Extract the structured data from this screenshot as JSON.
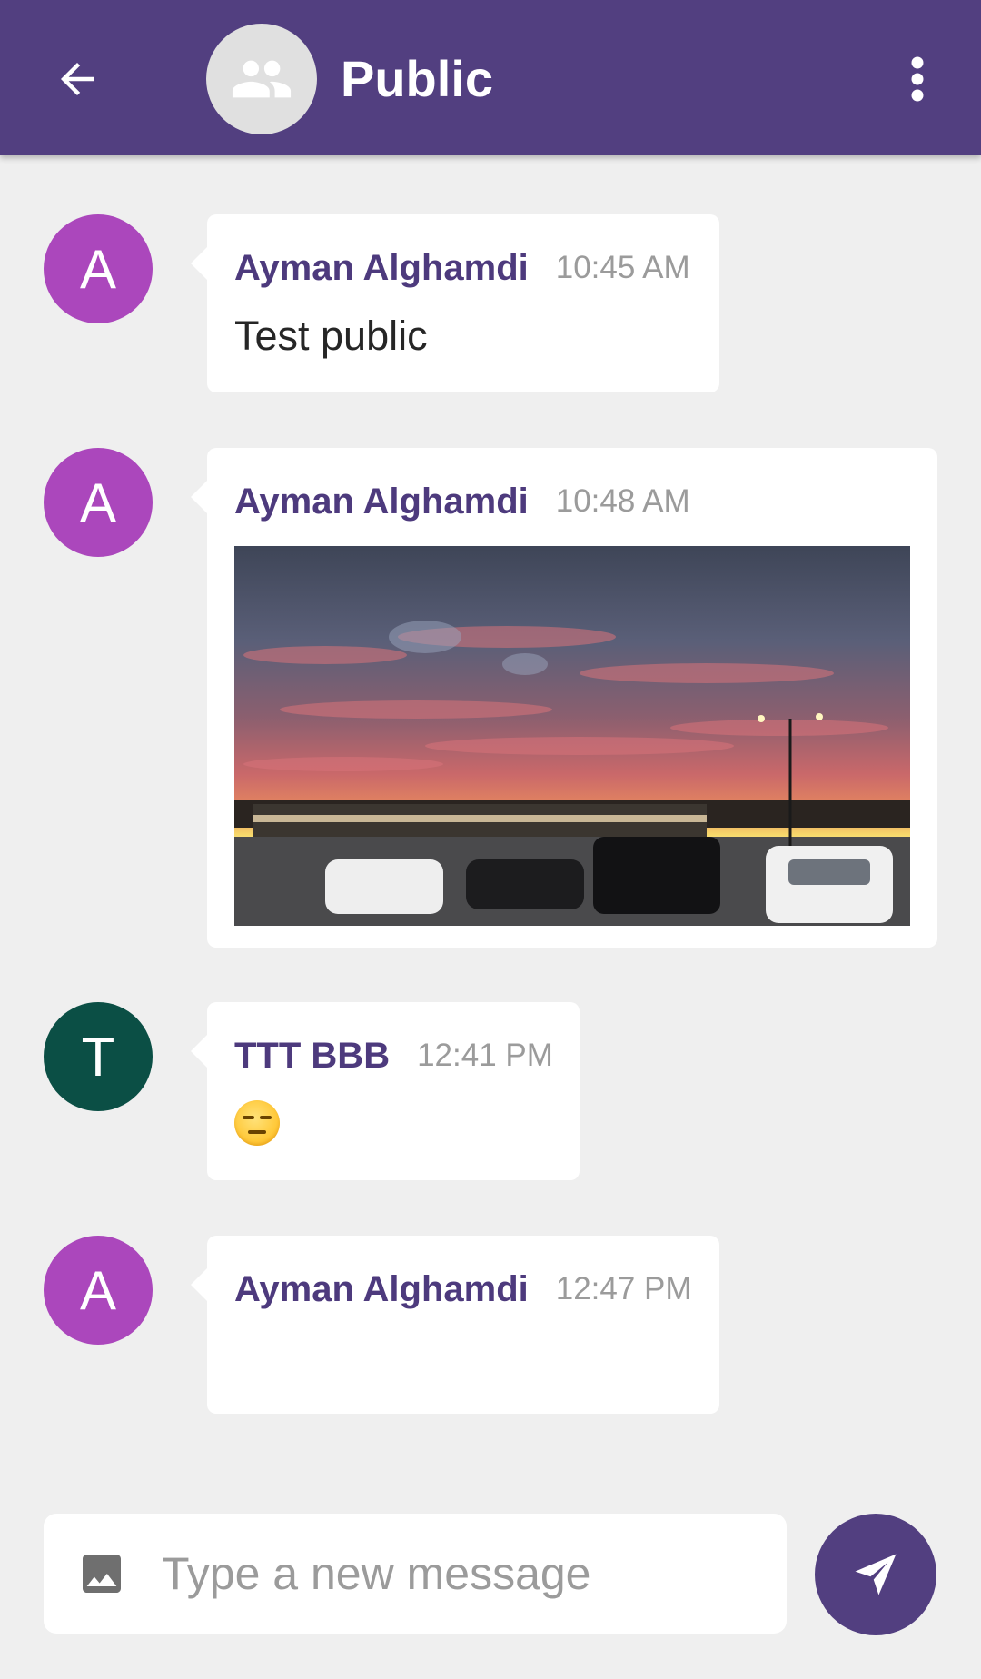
{
  "header": {
    "title": "Public",
    "bg_color": "#523f80",
    "back_icon": "arrow-back-icon",
    "group_icon": "group-icon",
    "menu_icon": "more-vert-icon"
  },
  "messages": [
    {
      "initial": "A",
      "avatar_color": "#ab47bc",
      "sender": "Ayman Alghamdi",
      "time": "10:45 AM",
      "text": "Test public"
    },
    {
      "initial": "A",
      "avatar_color": "#ab47bc",
      "sender": "Ayman Alghamdi",
      "time": "10:48 AM",
      "attachment": "sunset-photo"
    },
    {
      "initial": "T",
      "avatar_color": "#0b4f45",
      "sender": "TTT BBB",
      "time": "12:41 PM",
      "emoji": "expressionless-face-emoji"
    },
    {
      "initial": "A",
      "avatar_color": "#ab47bc",
      "sender": "Ayman Alghamdi",
      "time": "12:47 PM",
      "text": ""
    }
  ],
  "composer": {
    "placeholder": "Type a new message",
    "image_icon": "image-icon",
    "send_icon": "send-icon"
  }
}
